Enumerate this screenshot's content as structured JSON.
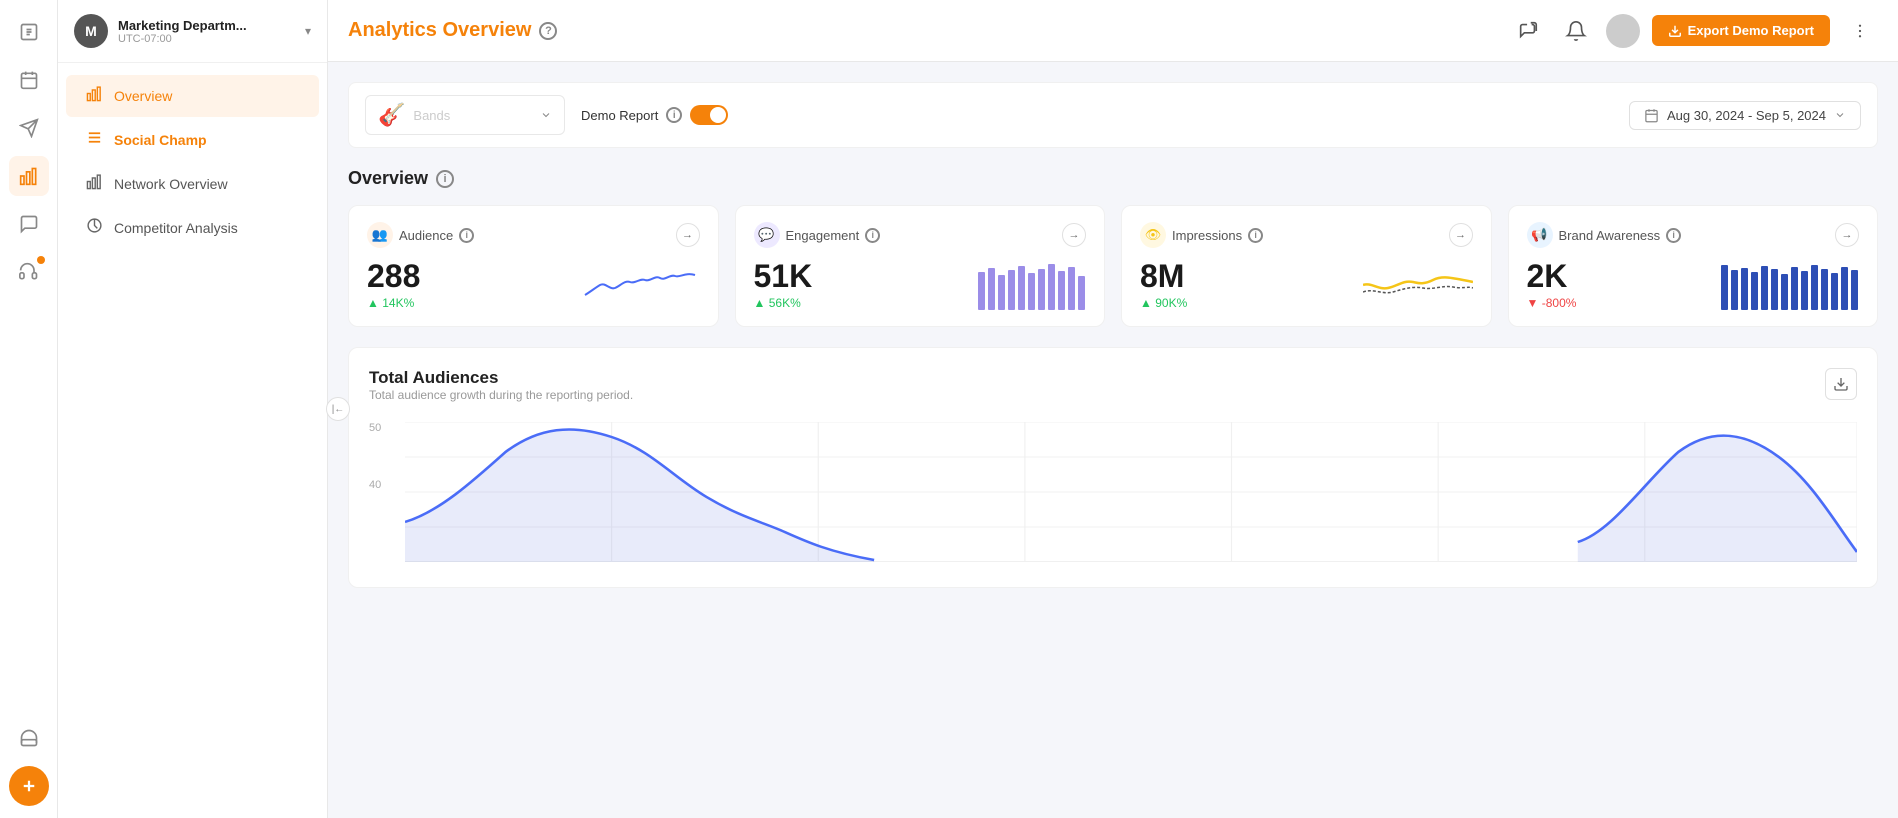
{
  "app": {
    "title": "Social Champ"
  },
  "sidebar_header": {
    "avatar_letter": "M",
    "company_name": "Marketing Departm...",
    "timezone": "UTC-07:00"
  },
  "nav": {
    "items": [
      {
        "id": "overview",
        "label": "Overview",
        "active": true
      },
      {
        "id": "social-champ",
        "label": "Social Champ",
        "highlighted": true
      },
      {
        "id": "network-overview",
        "label": "Network Overview"
      },
      {
        "id": "competitor-analysis",
        "label": "Competitor Analysis"
      }
    ]
  },
  "topbar": {
    "title": "Analytics Overview",
    "export_btn_label": "Export Demo Report",
    "help_icon": "?"
  },
  "filter_bar": {
    "profile_placeholder": "Bands",
    "demo_report_label": "Demo Report",
    "demo_report_enabled": true,
    "date_range": "Aug 30, 2024 - Sep 5, 2024"
  },
  "overview_section": {
    "title": "Overview",
    "cards": [
      {
        "id": "audience",
        "title": "Audience",
        "value": "288",
        "change": "14K%",
        "change_positive": true,
        "change_icon": "▲"
      },
      {
        "id": "engagement",
        "title": "Engagement",
        "value": "51K",
        "change": "56K%",
        "change_positive": true,
        "change_icon": "▲"
      },
      {
        "id": "impressions",
        "title": "Impressions",
        "value": "8M",
        "change": "90K%",
        "change_positive": true,
        "change_icon": "▲"
      },
      {
        "id": "brand-awareness",
        "title": "Brand Awareness",
        "value": "2K",
        "change": "-800%",
        "change_positive": false,
        "change_icon": "▼"
      }
    ]
  },
  "total_audiences": {
    "title": "Total Audiences",
    "subtitle": "Total audience growth during the reporting period.",
    "y_labels": [
      "50",
      "40"
    ],
    "download_icon": "⬇"
  }
}
